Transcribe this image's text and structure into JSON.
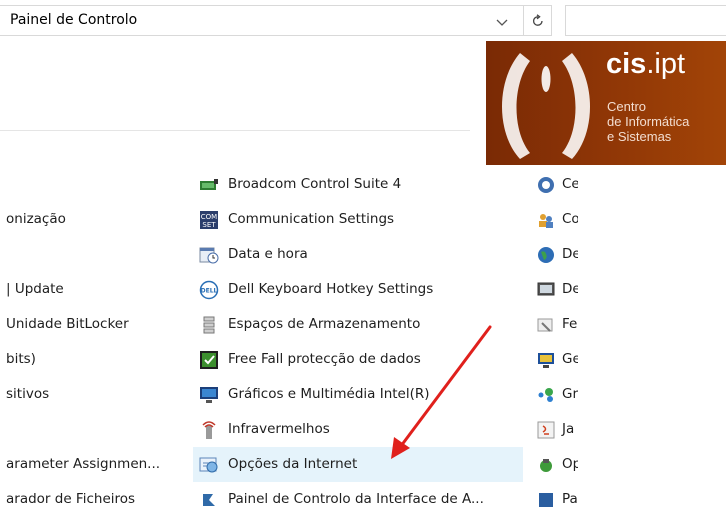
{
  "address_bar": {
    "path": "Painel de Controlo"
  },
  "logo": {
    "brand_bold": "cis",
    "brand_rest": ".ipt",
    "sub1": "Centro",
    "sub2": "de Informática",
    "sub3": "e Sistemas"
  },
  "left_column": [
    {
      "label": ""
    },
    {
      "label": "onização"
    },
    {
      "label": ""
    },
    {
      "label": "| Update"
    },
    {
      "label": "Unidade BitLocker"
    },
    {
      "label": "bits)"
    },
    {
      "label": "sitivos"
    },
    {
      "label": ""
    },
    {
      "label": "arameter Assignmen..."
    },
    {
      "label": "arador de Ficheiros"
    }
  ],
  "middle_column": [
    {
      "label": "Broadcom Control Suite 4",
      "icon": "broadcom-icon"
    },
    {
      "label": "Communication Settings",
      "icon": "communication-settings-icon"
    },
    {
      "label": "Data e hora",
      "icon": "date-time-icon"
    },
    {
      "label": "Dell Keyboard Hotkey Settings",
      "icon": "dell-icon"
    },
    {
      "label": "Espaços de Armazenamento",
      "icon": "storage-spaces-icon"
    },
    {
      "label": "Free Fall protecção de dados",
      "icon": "free-fall-icon"
    },
    {
      "label": "Gráficos e Multimédia Intel(R)",
      "icon": "intel-graphics-icon"
    },
    {
      "label": "Infravermelhos",
      "icon": "infrared-icon"
    },
    {
      "label": "Opções da Internet",
      "icon": "internet-options-icon",
      "selected": true
    },
    {
      "label": "Painel de Controlo da Interface de A...",
      "icon": "control-panel-interface-icon"
    }
  ],
  "right_column": [
    {
      "label": "Ce",
      "icon": "center-icon"
    },
    {
      "label": "Co",
      "icon": "users-icon"
    },
    {
      "label": "De",
      "icon": "globe-icon"
    },
    {
      "label": "De",
      "icon": "device-icon"
    },
    {
      "label": "Fe",
      "icon": "tools-icon"
    },
    {
      "label": "Ge",
      "icon": "monitor-icon"
    },
    {
      "label": "Gr",
      "icon": "homegroup-icon"
    },
    {
      "label": "Ja",
      "icon": "java-icon"
    },
    {
      "label": "Op",
      "icon": "power-icon"
    },
    {
      "label": "Pa",
      "icon": "panel-icon"
    }
  ],
  "colors": {
    "selection": "#e5f3fb",
    "annotation_arrow": "#e0201c",
    "logo_bg": "#8f3606"
  }
}
